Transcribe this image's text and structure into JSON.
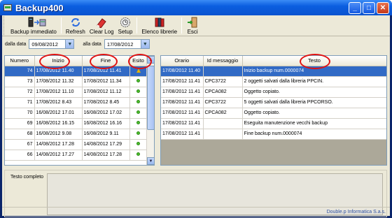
{
  "window": {
    "title": "Backup400"
  },
  "toolbar": {
    "backup_label": "Backup immediato",
    "refresh_label": "Refresh",
    "clear_log_label": "Clear Log",
    "setup_label": "Setup",
    "library_list_label": "Elenco librerie",
    "exit_label": "Esci"
  },
  "filters": {
    "from_label": "dalla data",
    "from_value": "09/08/2012",
    "to_label": "alla data",
    "to_value": "17/08/2012"
  },
  "left_grid": {
    "headers": [
      "Numero",
      "Inizio",
      "Fine",
      "Esito"
    ],
    "rows": [
      {
        "num": "74",
        "start": "17/08/2012 11.40",
        "end": "17/08/2012 11.41",
        "status": "warning"
      },
      {
        "num": "73",
        "start": "17/08/2012 11.32",
        "end": "17/08/2012 11.34",
        "status": "ok"
      },
      {
        "num": "72",
        "start": "17/08/2012 11.10",
        "end": "17/08/2012 11.12",
        "status": "ok"
      },
      {
        "num": "71",
        "start": "17/08/2012 8.43",
        "end": "17/08/2012 8.45",
        "status": "ok"
      },
      {
        "num": "70",
        "start": "16/08/2012 17.01",
        "end": "16/08/2012 17.02",
        "status": "ok"
      },
      {
        "num": "69",
        "start": "16/08/2012 16.15",
        "end": "16/08/2012 16.16",
        "status": "ok"
      },
      {
        "num": "68",
        "start": "16/08/2012 9.08",
        "end": "16/08/2012 9.11",
        "status": "ok"
      },
      {
        "num": "67",
        "start": "14/08/2012 17.28",
        "end": "14/08/2012 17.29",
        "status": "ok"
      },
      {
        "num": "66",
        "start": "14/08/2012 17.27",
        "end": "14/08/2012 17.28",
        "status": "ok"
      }
    ]
  },
  "right_grid": {
    "headers": [
      "Orario",
      "Id messaggio",
      "Testo"
    ],
    "rows": [
      {
        "time": "17/08/2012 11.40",
        "id": "",
        "text": "Inizio backup num.0000074"
      },
      {
        "time": "17/08/2012 11.41",
        "id": "CPC3722",
        "text": "2 oggetti salvati dalla libreria PPCIN."
      },
      {
        "time": "17/08/2012 11.41",
        "id": "CPCA082",
        "text": "Oggetto copiato."
      },
      {
        "time": "17/08/2012 11.41",
        "id": "CPC3722",
        "text": "5 oggetti salvati dalla libreria PPCORSO."
      },
      {
        "time": "17/08/2012 11.41",
        "id": "CPCA082",
        "text": "Oggetto copiato."
      },
      {
        "time": "17/08/2012 11.41",
        "id": "",
        "text": "Eseguita manutenzione vecchi backup"
      },
      {
        "time": "17/08/2012 11.41",
        "id": "",
        "text": "Fine backup num.0000074"
      }
    ]
  },
  "detail": {
    "label": "Testo completo"
  },
  "status_bar": {
    "company": "Double.p Informatica S.a.s."
  },
  "colors": {
    "selection": "#316ac5",
    "annotation": "#e01010",
    "status_ok": "#4bbf2d",
    "status_warn": "#e5b300"
  }
}
